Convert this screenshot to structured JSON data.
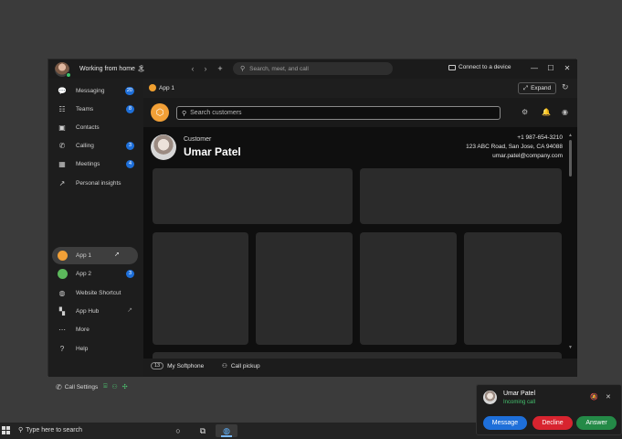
{
  "titlebar": {
    "status": "Working from home 🏝",
    "search_placeholder": "Search, meet, and call",
    "connect_label": "Connect to a device",
    "back": "‹",
    "forward": "›",
    "new": "+",
    "minimize": "—",
    "maximize": "☐",
    "close": "✕"
  },
  "sidebar": {
    "items": [
      {
        "label": "Messaging",
        "badge": "20"
      },
      {
        "label": "Teams",
        "badge": "8"
      },
      {
        "label": "Contacts"
      },
      {
        "label": "Calling",
        "badge": "3"
      },
      {
        "label": "Meetings",
        "badge": "4"
      },
      {
        "label": "Personal insights"
      }
    ],
    "apps": [
      {
        "label": "App 1"
      },
      {
        "label": "App 2",
        "badge": "3"
      },
      {
        "label": "Website Shortcut"
      },
      {
        "label": "App Hub"
      },
      {
        "label": "More"
      },
      {
        "label": "Help"
      }
    ],
    "call_settings": "Call Settings"
  },
  "tabbar": {
    "tab_label": "App 1",
    "expand_label": "Expand"
  },
  "app": {
    "search_placeholder": "Search customers"
  },
  "customer": {
    "label": "Customer",
    "name": "Umar Patel",
    "phone": "+1 987-654-3210",
    "address": "123 ABC Road, San Jose, CA 94088",
    "email": "umar.patel@company.com"
  },
  "bottombar": {
    "softphone_num": "13",
    "softphone_label": "My Softphone",
    "pickup_label": "Call pickup"
  },
  "taskbar": {
    "search_label": "Type here to search"
  },
  "toast": {
    "name": "Umar Patel",
    "status": "Incoming call",
    "message_label": "Message",
    "decline_label": "Decline",
    "answer_label": "Answer"
  },
  "colors": {
    "accent_blue": "#1e6fd9",
    "decline_red": "#d8242f",
    "answer_green": "#248a47",
    "app1_orange": "#f2a037",
    "app2_green": "#5cb85c"
  }
}
